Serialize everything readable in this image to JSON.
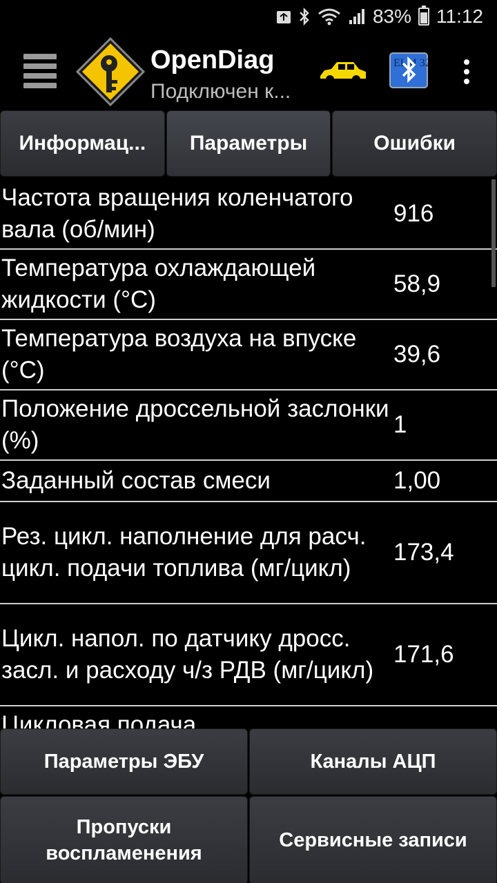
{
  "status_bar": {
    "battery_percent": "83%",
    "time": "11:12"
  },
  "app_bar": {
    "title": "OpenDiag",
    "subtitle": "Подключен к..."
  },
  "tabs": [
    {
      "label": "Информац..."
    },
    {
      "label": "Параметры"
    },
    {
      "label": "Ошибки"
    }
  ],
  "parameters": [
    {
      "name": "Частота вращения коленчатого вала (об/мин)",
      "value": "916"
    },
    {
      "name": "Температура охлаждающей жидкости (°C)",
      "value": "58,9"
    },
    {
      "name": "Температура воздуха на впуске (°C)",
      "value": "39,6"
    },
    {
      "name": "Положение дроссельной заслонки (%)",
      "value": "1"
    },
    {
      "name": "Заданный состав смеси",
      "value": "1,00"
    },
    {
      "name": "Рез. цикл. наполнение для расч. цикл. подачи топлива (мг/цикл)",
      "value": "173,4"
    },
    {
      "name": "Цикл. напол. по датчику дросс. засл. и расходу ч/з РДВ (мг/цикл)",
      "value": "171,6"
    },
    {
      "name": "Цикловая подача",
      "value": ""
    }
  ],
  "bottom_buttons": {
    "ecu_params": "Параметры ЭБУ",
    "adc_channels": "Каналы АЦП",
    "misfires_line1": "Пропуски",
    "misfires_line2": "воспламенения",
    "service_records": "Сервисные записи"
  },
  "bt_icon_text": "ELM 327",
  "colors": {
    "background": "#000000",
    "button_bg": "#34363b",
    "logo_yellow": "#f5c400",
    "car_yellow": "#f5d800",
    "bluetooth_blue": "#2f6fd6",
    "divider": "#d0d0d0"
  },
  "icons": [
    "wifi-icon",
    "bluetooth-status-icon",
    "signal-icon",
    "battery-icon",
    "hamburger-menu-icon",
    "opendiag-logo-icon",
    "car-icon",
    "elm327-bluetooth-icon",
    "overflow-menu-icon"
  ]
}
